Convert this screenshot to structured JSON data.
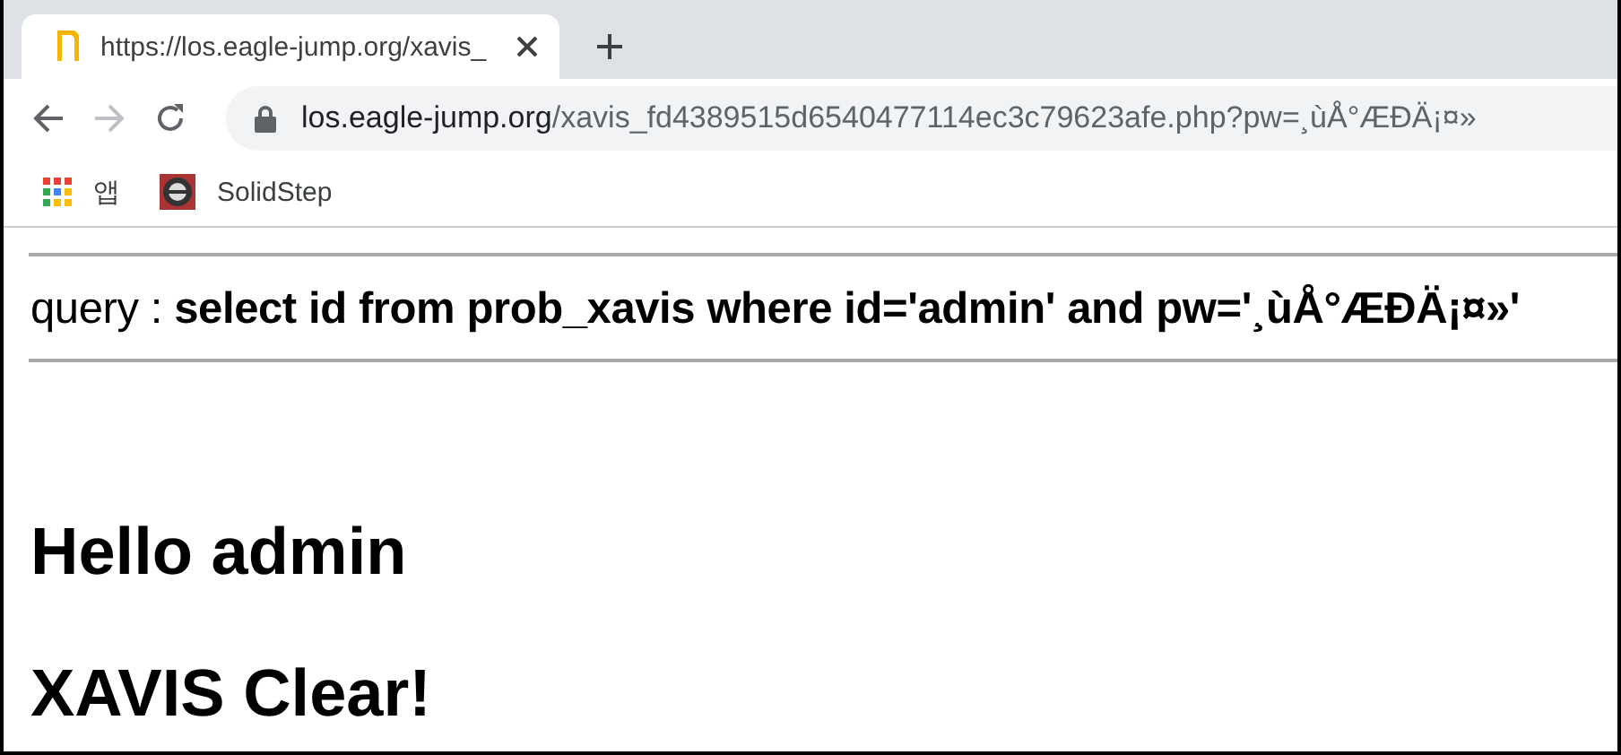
{
  "tab": {
    "title": "https://los.eagle-jump.org/xavis_",
    "selected": true
  },
  "address": {
    "host": "los.eagle-jump.org",
    "path": "/xavis_fd4389515d6540477114ec3c79623afe.php?pw=¸ùÅ°ÆÐÄ¡¤»"
  },
  "bookmarks": [
    {
      "kind": "apps",
      "label": "앱"
    },
    {
      "kind": "site",
      "label": "SolidStep"
    }
  ],
  "query": "query : **select id from prob_xavis where id='admin' and pw='¸ùÅ°ÆÐÄ¡¤»'**",
  "headings": [
    "Hello admin",
    "XAVIS Clear!"
  ]
}
